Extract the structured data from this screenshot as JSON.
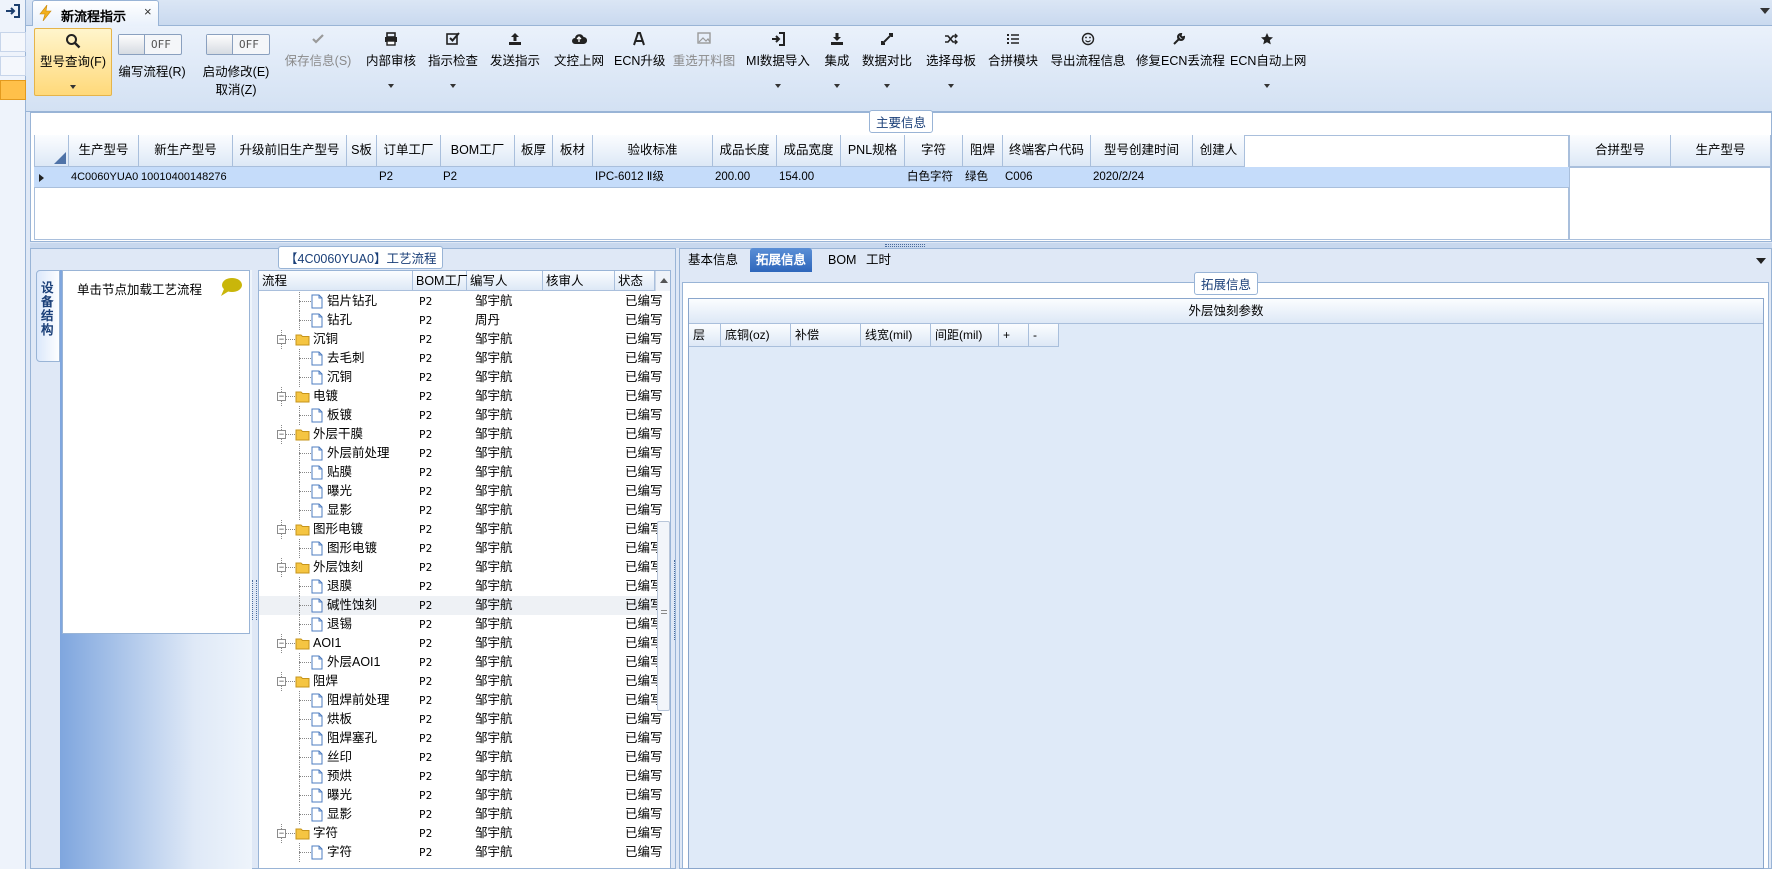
{
  "window": {
    "tab_title": "新流程指示",
    "tab_close": "×",
    "colors": {
      "accent": "#2d66bb",
      "selected_row": "#c5dcfa",
      "panel_bg": "#dfe8f6",
      "border": "#99b4d6"
    }
  },
  "toolbar": {
    "items": [
      {
        "label": "型号查询(F)",
        "icon": "search-icon",
        "dropdown": true,
        "selected": true
      },
      {
        "label": "编写流程(R)",
        "toggle": "OFF"
      },
      {
        "label": "启动修改(E)",
        "label2": "取消(Z)",
        "toggle": "OFF"
      },
      {
        "label": "保存信息(S)",
        "icon": "check-icon",
        "disabled": true
      },
      {
        "label": "内部审核",
        "icon": "print-icon",
        "dropdown": true
      },
      {
        "label": "指示检查",
        "icon": "checkbox-icon",
        "dropdown": true
      },
      {
        "label": "发送指示",
        "icon": "upload-icon"
      },
      {
        "label": "文控上网",
        "icon": "cloud-icon"
      },
      {
        "label": "ECN升级",
        "icon": "ecn-icon"
      },
      {
        "label": "重选开料图",
        "icon": "image-icon",
        "disabled": true
      },
      {
        "label": "MI数据导入",
        "icon": "import-icon",
        "dropdown": true
      },
      {
        "label": "集成",
        "icon": "download-icon",
        "dropdown": true
      },
      {
        "label": "数据对比",
        "icon": "compare-icon",
        "dropdown": true
      },
      {
        "label": "选择母板",
        "icon": "shuffle-icon",
        "dropdown": true
      },
      {
        "label": "合拼模块",
        "icon": "list-icon"
      },
      {
        "label": "导出流程信息",
        "icon": "smile-icon"
      },
      {
        "label": "修复ECN丢流程",
        "icon": "wrench-icon"
      },
      {
        "label": "ECN自动上网",
        "icon": "star-icon",
        "dropdown": true
      }
    ]
  },
  "main_info": {
    "legend": "主要信息",
    "columns": [
      "生产型号",
      "新生产型号",
      "升级前旧生产型号",
      "S板",
      "订单工厂",
      "BOM工厂",
      "板厚",
      "板材",
      "验收标准",
      "成品长度",
      "成品宽度",
      "PNL规格",
      "字符",
      "阻焊",
      "终端客户代码",
      "型号创建时间",
      "创建人"
    ],
    "rows": [
      [
        "4C0060YUA0",
        "10010400148276",
        "",
        "",
        "P2",
        "P2",
        "",
        "",
        "IPC-6012 Ⅱ级",
        "200.00",
        "154.00",
        "",
        "白色字符",
        "绿色",
        "C006",
        "2020/2/24",
        ""
      ]
    ],
    "merge_columns": [
      "合拼型号",
      "生产型号"
    ]
  },
  "process_panel": {
    "legend": "【4C0060YUA0】工艺流程",
    "side_tab": "设备结构",
    "side_hint": "单击节点加载工艺流程",
    "columns": [
      "流程",
      "BOM工厂",
      "编写人",
      "核审人",
      "状态"
    ],
    "rows": [
      {
        "name": "铝片钻孔",
        "type": "file",
        "bom": "P2",
        "author": "邹宇航",
        "reviewer": "",
        "status": "已编写"
      },
      {
        "name": "钻孔",
        "type": "file",
        "bom": "P2",
        "author": "周丹",
        "reviewer": "",
        "status": "已编写"
      },
      {
        "name": "沉铜",
        "type": "folder",
        "bom": "P2",
        "author": "邹宇航",
        "reviewer": "",
        "status": "已编写"
      },
      {
        "name": "去毛刺",
        "type": "file",
        "bom": "P2",
        "author": "邹宇航",
        "reviewer": "",
        "status": "已编写"
      },
      {
        "name": "沉铜",
        "type": "file",
        "bom": "P2",
        "author": "邹宇航",
        "reviewer": "",
        "status": "已编写"
      },
      {
        "name": "电镀",
        "type": "folder",
        "bom": "P2",
        "author": "邹宇航",
        "reviewer": "",
        "status": "已编写"
      },
      {
        "name": "板镀",
        "type": "file",
        "bom": "P2",
        "author": "邹宇航",
        "reviewer": "",
        "status": "已编写"
      },
      {
        "name": "外层干膜",
        "type": "folder",
        "bom": "P2",
        "author": "邹宇航",
        "reviewer": "",
        "status": "已编写"
      },
      {
        "name": "外层前处理",
        "type": "file",
        "bom": "P2",
        "author": "邹宇航",
        "reviewer": "",
        "status": "已编写"
      },
      {
        "name": "贴膜",
        "type": "file",
        "bom": "P2",
        "author": "邹宇航",
        "reviewer": "",
        "status": "已编写"
      },
      {
        "name": "曝光",
        "type": "file",
        "bom": "P2",
        "author": "邹宇航",
        "reviewer": "",
        "status": "已编写"
      },
      {
        "name": "显影",
        "type": "file",
        "bom": "P2",
        "author": "邹宇航",
        "reviewer": "",
        "status": "已编写"
      },
      {
        "name": "图形电镀",
        "type": "folder",
        "bom": "P2",
        "author": "邹宇航",
        "reviewer": "",
        "status": "已编写"
      },
      {
        "name": "图形电镀",
        "type": "file",
        "bom": "P2",
        "author": "邹宇航",
        "reviewer": "",
        "status": "已编写"
      },
      {
        "name": "外层蚀刻",
        "type": "folder",
        "bom": "P2",
        "author": "邹宇航",
        "reviewer": "",
        "status": "已编写"
      },
      {
        "name": "退膜",
        "type": "file",
        "bom": "P2",
        "author": "邹宇航",
        "reviewer": "",
        "status": "已编写"
      },
      {
        "name": "碱性蚀刻",
        "type": "file",
        "bom": "P2",
        "author": "邹宇航",
        "reviewer": "",
        "status": "已编写",
        "selected": true
      },
      {
        "name": "退锡",
        "type": "file",
        "bom": "P2",
        "author": "邹宇航",
        "reviewer": "",
        "status": "已编写"
      },
      {
        "name": "AOI1",
        "type": "folder",
        "bom": "P2",
        "author": "邹宇航",
        "reviewer": "",
        "status": "已编写"
      },
      {
        "name": "外层AOI1",
        "type": "file",
        "bom": "P2",
        "author": "邹宇航",
        "reviewer": "",
        "status": "已编写"
      },
      {
        "name": "阻焊",
        "type": "folder",
        "bom": "P2",
        "author": "邹宇航",
        "reviewer": "",
        "status": "已编写"
      },
      {
        "name": "阻焊前处理",
        "type": "file",
        "bom": "P2",
        "author": "邹宇航",
        "reviewer": "",
        "status": "已编写"
      },
      {
        "name": "烘板",
        "type": "file",
        "bom": "P2",
        "author": "邹宇航",
        "reviewer": "",
        "status": "已编写"
      },
      {
        "name": "阻焊塞孔",
        "type": "file",
        "bom": "P2",
        "author": "邹宇航",
        "reviewer": "",
        "status": "已编写"
      },
      {
        "name": "丝印",
        "type": "file",
        "bom": "P2",
        "author": "邹宇航",
        "reviewer": "",
        "status": "已编写"
      },
      {
        "name": "预烘",
        "type": "file",
        "bom": "P2",
        "author": "邹宇航",
        "reviewer": "",
        "status": "已编写"
      },
      {
        "name": "曝光",
        "type": "file",
        "bom": "P2",
        "author": "邹宇航",
        "reviewer": "",
        "status": "已编写"
      },
      {
        "name": "显影",
        "type": "file",
        "bom": "P2",
        "author": "邹宇航",
        "reviewer": "",
        "status": "已编写"
      },
      {
        "name": "字符",
        "type": "folder",
        "bom": "P2",
        "author": "邹宇航",
        "reviewer": "",
        "status": "已编写"
      },
      {
        "name": "字符",
        "type": "file",
        "bom": "P2",
        "author": "邹宇航",
        "reviewer": "",
        "status": "已编写"
      }
    ]
  },
  "right_panel": {
    "tabs": [
      {
        "label": "基本信息",
        "active": false
      },
      {
        "label": "拓展信息",
        "active": true
      },
      {
        "label": "BOM",
        "active": false
      },
      {
        "label": "工时",
        "active": false
      }
    ],
    "legend": "拓展信息",
    "section_title": "外层蚀刻参数",
    "columns": [
      "层",
      "底铜(oz)",
      "补偿",
      "线宽(mil)",
      "间距(mil)",
      "+",
      "-"
    ]
  }
}
